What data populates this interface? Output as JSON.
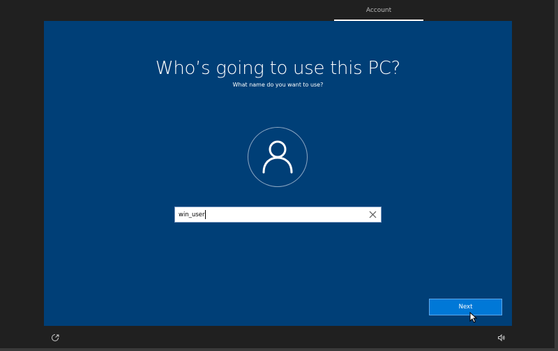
{
  "topbar": {
    "current_step": "Account"
  },
  "page": {
    "title": "Who’s going to use this PC?",
    "subtitle": "What name do you want to use?"
  },
  "name_field": {
    "value": "win_user",
    "clear_icon": "close-icon"
  },
  "footer": {
    "next_label": "Next",
    "left_icon": "ease-of-access-icon",
    "right_icon": "volume-icon"
  },
  "colors": {
    "panel": "#003f77",
    "accent": "#0078d7",
    "chrome": "#202020"
  }
}
